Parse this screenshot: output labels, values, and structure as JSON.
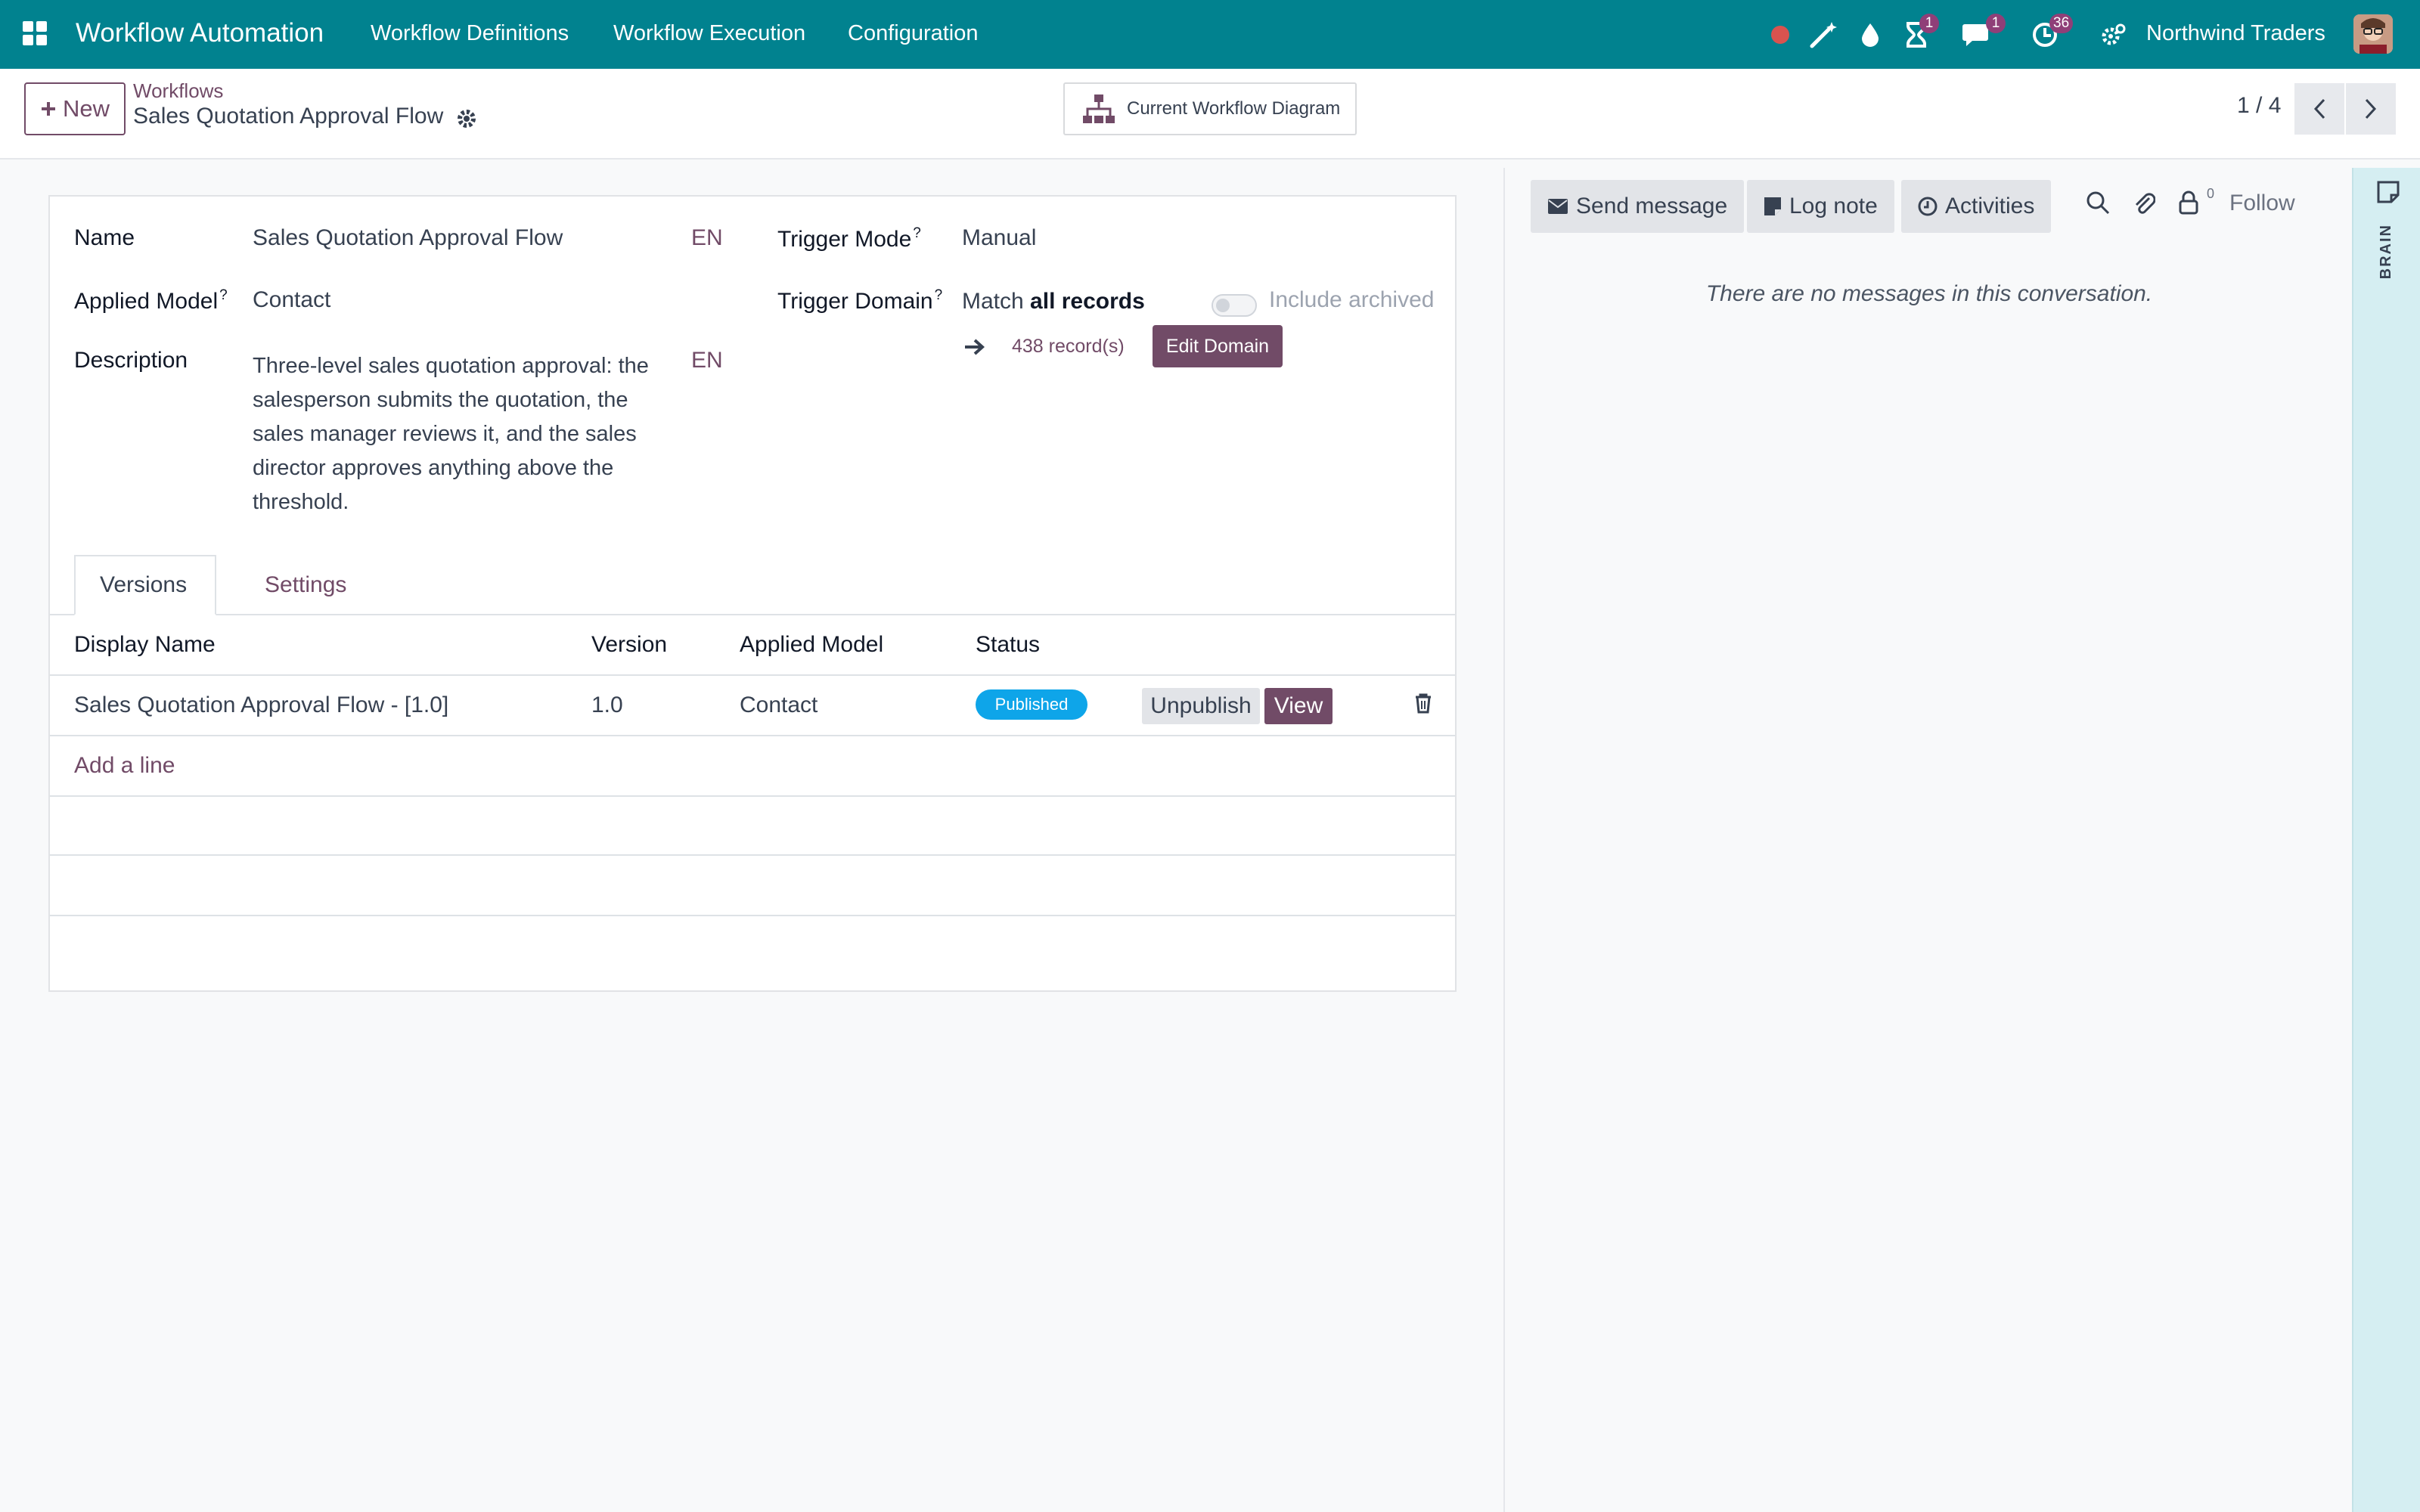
{
  "navbar": {
    "app_title": "Workflow Automation",
    "menu": [
      "Workflow Definitions",
      "Workflow Execution",
      "Configuration"
    ],
    "activity_badge": "1",
    "messages_badge": "1",
    "clock_badge": "36",
    "company": "Northwind Traders"
  },
  "control_panel": {
    "new_label": "New",
    "breadcrumb_parent": "Workflows",
    "breadcrumb_current": "Sales Quotation Approval Flow",
    "diagram_button": "Current Workflow Diagram",
    "pager": "1 / 4"
  },
  "form": {
    "name_label": "Name",
    "name_value": "Sales Quotation Approval Flow",
    "lang": "EN",
    "applied_model_label": "Applied Model",
    "applied_model_value": "Contact",
    "description_label": "Description",
    "description_value": "Three-level sales quotation approval: the salesperson submits the quotation, the sales manager reviews it, and the sales director approves anything above the threshold.",
    "trigger_mode_label": "Trigger Mode",
    "trigger_mode_value": "Manual",
    "trigger_domain_label": "Trigger Domain",
    "match_prefix": "Match",
    "match_value": "all records",
    "include_archived_label": "Include archived",
    "include_archived": false,
    "records_link": "438 record(s)",
    "edit_domain_label": "Edit Domain",
    "help_mark": "?"
  },
  "tabs": [
    "Versions",
    "Settings"
  ],
  "versions_table": {
    "columns": [
      "Display Name",
      "Version",
      "Applied Model",
      "Status"
    ],
    "rows": [
      {
        "display_name": "Sales Quotation Approval Flow - [1.0]",
        "version": "1.0",
        "applied_model": "Contact",
        "status": "Published",
        "unpublish_label": "Unpublish",
        "view_label": "View"
      }
    ],
    "add_line": "Add a line"
  },
  "chatter": {
    "send_message": "Send message",
    "log_note": "Log note",
    "activities": "Activities",
    "followers_count": "0",
    "follow": "Follow",
    "empty_text": "There are no messages in this conversation."
  },
  "side_panel": {
    "label": "BRAIN"
  },
  "colors": {
    "navbar": "#01828f",
    "primary": "#714b67",
    "status_published": "#0ea5e9",
    "record_dot": "#d9534f"
  }
}
